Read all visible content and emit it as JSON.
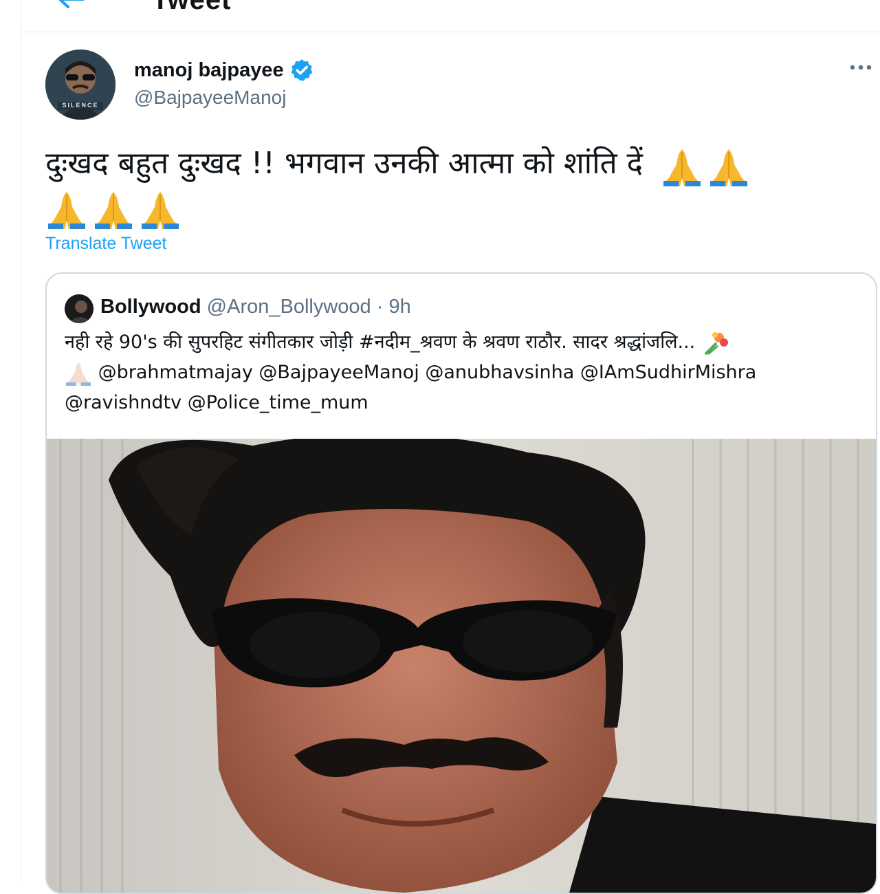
{
  "header": {
    "title": "Tweet"
  },
  "tweet": {
    "display_name": "manoj bajpayee",
    "handle": "@BajpayeeManoj",
    "text": "दुःखद बहुत दुःखद !! भगवान उनकी आत्मा को शांति दें",
    "emoji_count": 5,
    "translate_label": "Translate Tweet",
    "avatar_caption": "SILENCE"
  },
  "quoted": {
    "name": "Bollywood",
    "handle": "@Aron_Bollywood",
    "separator": "·",
    "time": "9h",
    "line1": "नही रहे 90's की सुपरहिट संगीतकार जोड़ी #नदीम_श्रवण के श्रवण राठौर. सादर श्रद्धांजलि...",
    "line2": "@brahmatmajay @BajpayeeManoj @anubhavsinha @IAmSudhirMishra",
    "line3": "@ravishndtv @Police_time_mum"
  },
  "colors": {
    "link": "#1da1f2",
    "muted": "#5b7083",
    "verified": "#1da1f2",
    "border": "#cfd9de"
  },
  "icons": [
    "back-arrow-icon",
    "verified-badge-icon",
    "more-options-icon",
    "folded-hands-emoji-icon",
    "bouquet-emoji-icon"
  ]
}
